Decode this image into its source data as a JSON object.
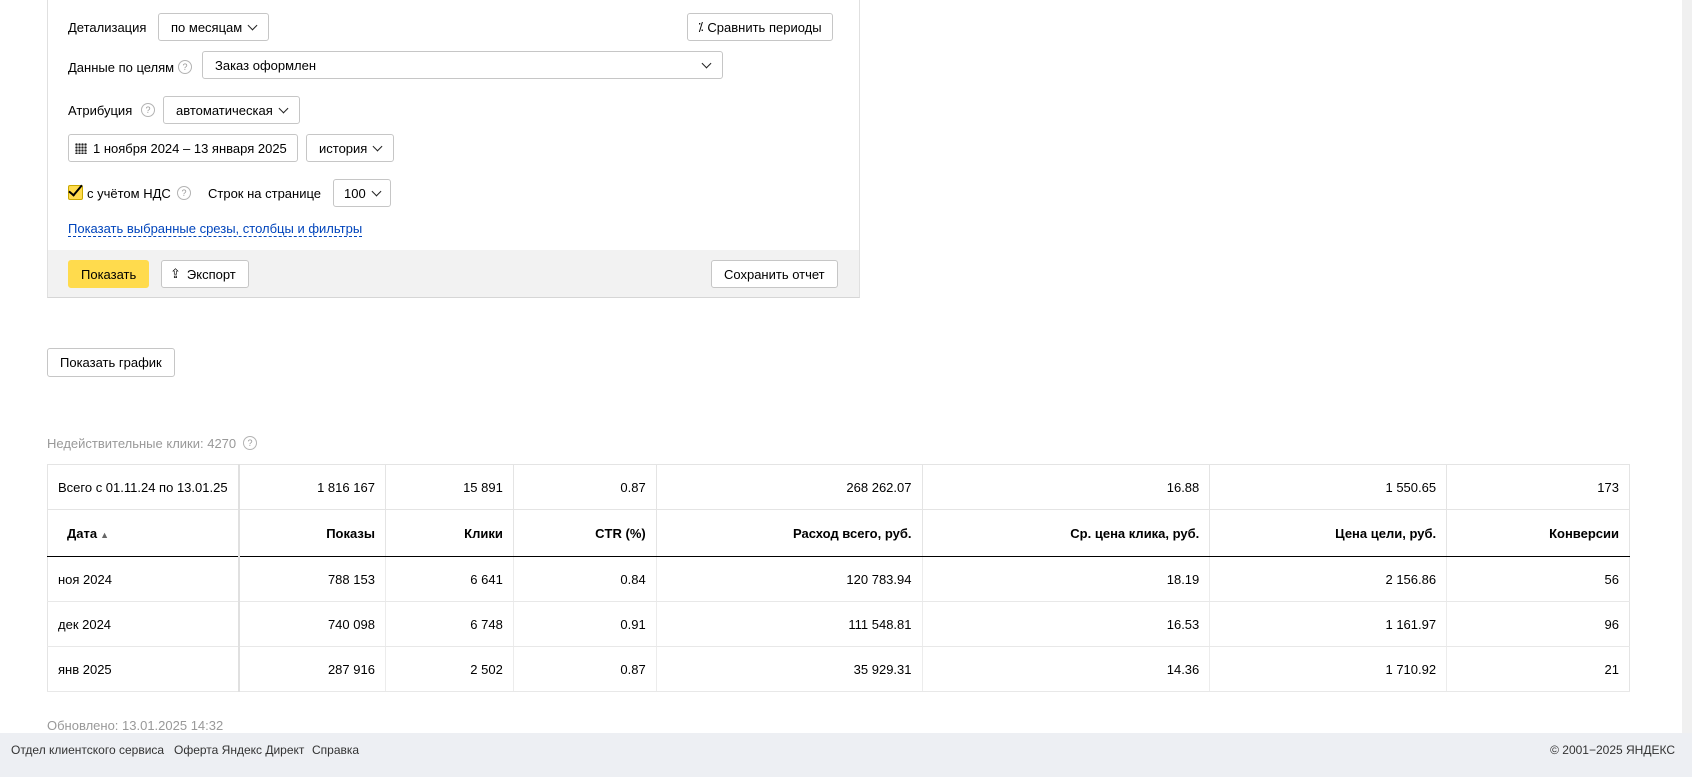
{
  "form": {
    "detail_label": "Детализация",
    "detail_value": "по месяцам",
    "compare_button": "Сравнить периоды",
    "goals_label": "Данные по целям",
    "goals_value": "Заказ оформлен",
    "attribution_label": "Атрибуция",
    "attribution_value": "автоматическая",
    "date_range": "1 ноября 2024 – 13 января 2025",
    "history_value": "история",
    "vat_label": "с учётом НДС",
    "rows_label": "Строк на странице",
    "rows_value": "100",
    "show_filters_link": "Показать выбранные срезы, столбцы и фильтры",
    "show_button": "Показать",
    "export_button": "Экспорт",
    "save_button": "Сохранить отчет"
  },
  "show_chart_button": "Показать график",
  "invalid_clicks": "Недействительные клики: 4270",
  "table": {
    "total": [
      "Всего с 01.11.24 по 13.01.25",
      "1 816 167",
      "15 891",
      "0.87",
      "268 262.07",
      "16.88",
      "1 550.65",
      "173"
    ],
    "headers": [
      "Дата",
      "Показы",
      "Клики",
      "CTR (%)",
      "Расход всего, руб.",
      "Ср. цена клика, руб.",
      "Цена цели, руб.",
      "Конверсии"
    ],
    "rows": [
      [
        "ноя 2024",
        "788 153",
        "6 641",
        "0.84",
        "120 783.94",
        "18.19",
        "2 156.86",
        "56"
      ],
      [
        "дек 2024",
        "740 098",
        "6 748",
        "0.91",
        "111 548.81",
        "16.53",
        "1 161.97",
        "96"
      ],
      [
        "янв 2025",
        "287 916",
        "2 502",
        "0.87",
        "35 929.31",
        "14.36",
        "1 710.92",
        "21"
      ]
    ]
  },
  "updated": "Обновлено: 13.01.2025 14:32",
  "footer": {
    "link1": "Отдел клиентского сервиса",
    "link2": "Оферта Яндекс Директ",
    "link3": "Справка",
    "copyright": "© 2001−2025 ЯНДЕКС"
  }
}
